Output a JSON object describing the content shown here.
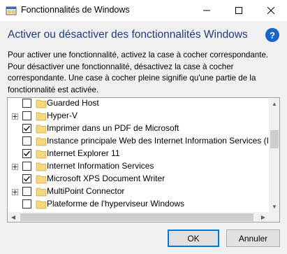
{
  "window": {
    "title": "Fonctionnalités de Windows",
    "icon": "windows-features-icon"
  },
  "heading": "Activer ou désactiver des fonctionnalités Windows",
  "description": "Pour activer une fonctionnalité, activez la case à cocher correspondante. Pour désactiver une fonctionnalité, désactivez la case à cocher correspondante. Une case à cocher pleine signifie qu'une partie de la fonctionnalité est activée.",
  "features": [
    {
      "label": "Guarded Host",
      "checked": false,
      "expandable": false
    },
    {
      "label": "Hyper-V",
      "checked": false,
      "expandable": true
    },
    {
      "label": "Imprimer dans un PDF de Microsoft",
      "checked": true,
      "expandable": false
    },
    {
      "label": "Instance principale Web des Internet Information Services (IIS",
      "checked": false,
      "expandable": false
    },
    {
      "label": "Internet Explorer 11",
      "checked": true,
      "expandable": false
    },
    {
      "label": "Internet Information Services",
      "checked": false,
      "expandable": true
    },
    {
      "label": "Microsoft XPS Document Writer",
      "checked": true,
      "expandable": false
    },
    {
      "label": "MultiPoint Connector",
      "checked": false,
      "expandable": true
    },
    {
      "label": "Plateforme de l'hyperviseur Windows",
      "checked": false,
      "expandable": false
    }
  ],
  "buttons": {
    "ok": "OK",
    "cancel": "Annuler"
  },
  "colors": {
    "heading": "#1f3d7a",
    "accent": "#0078d7",
    "folder": "#f5d77e"
  }
}
